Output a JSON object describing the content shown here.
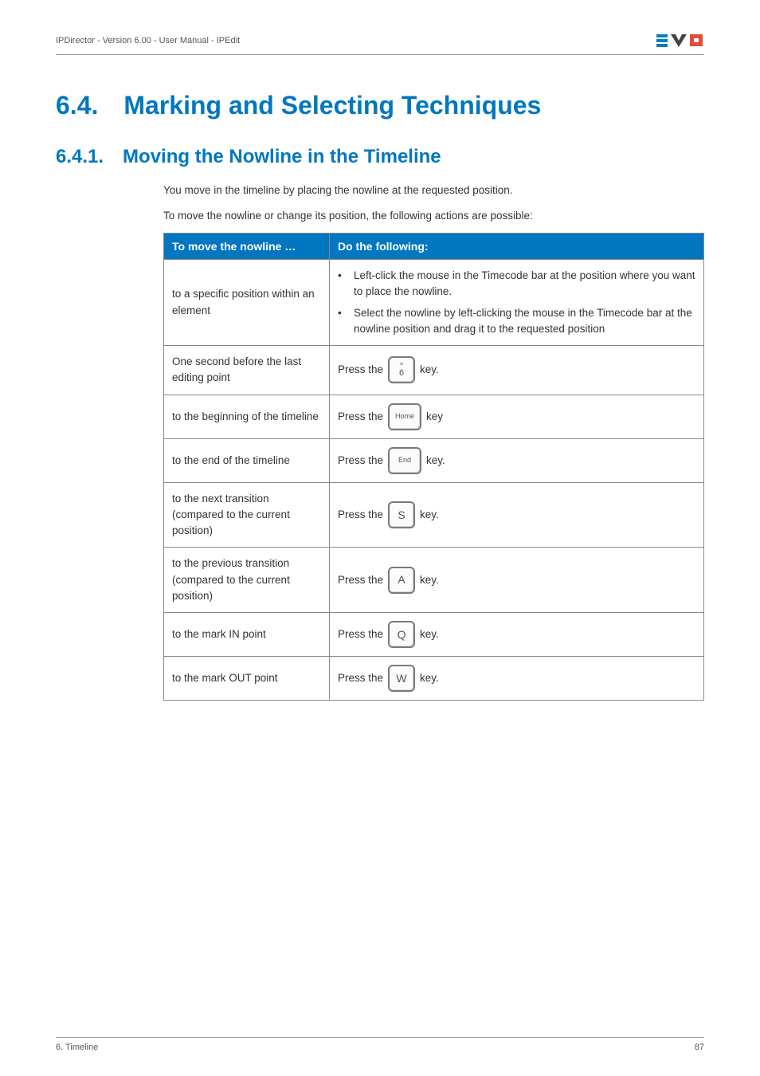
{
  "header": {
    "left": "IPDirector - Version 6.00 - User Manual - IPEdit"
  },
  "h1": {
    "num": "6.4.",
    "title": "Marking and Selecting Techniques"
  },
  "h2": {
    "num": "6.4.1.",
    "title": "Moving the Nowline in the Timeline"
  },
  "intro": {
    "p1": "You move in the timeline by placing the nowline at the requested position.",
    "p2": "To move the nowline or change its position, the following actions are possible:"
  },
  "table": {
    "head": {
      "c1": "To move the nowline …",
      "c2": "Do the following:"
    },
    "rows": [
      {
        "left": "to a specific position within an element",
        "bullets": [
          "Left-click the mouse in the Timecode bar at the position where you want to place the nowline.",
          "Select the nowline by left-clicking the mouse in the Timecode bar at the nowline position and drag it to the requested position"
        ]
      },
      {
        "left": "One second before the last editing point",
        "press": "Press the",
        "key": {
          "type": "stack",
          "top": "^",
          "bottom": "6"
        },
        "suffix": "key."
      },
      {
        "left": "to the beginning of the timeline",
        "press": "Press the",
        "key": {
          "type": "small",
          "label": "Home"
        },
        "suffix": "key"
      },
      {
        "left": "to the end of the timeline",
        "press": "Press the",
        "key": {
          "type": "small",
          "label": "End"
        },
        "suffix": "key."
      },
      {
        "left": "to the next transition (compared to the current position)",
        "press": "Press the",
        "key": {
          "type": "char",
          "label": "S"
        },
        "suffix": "key."
      },
      {
        "left": "to the previous transition (compared to the current position)",
        "press": "Press the",
        "key": {
          "type": "char",
          "label": "A"
        },
        "suffix": "key."
      },
      {
        "left": "to the mark IN point",
        "press": "Press the",
        "key": {
          "type": "char",
          "label": "Q"
        },
        "suffix": "key."
      },
      {
        "left": "to the mark OUT point",
        "press": "Press the",
        "key": {
          "type": "char",
          "label": "W"
        },
        "suffix": "key."
      }
    ]
  },
  "footer": {
    "left": "6. Timeline",
    "right": "87"
  }
}
